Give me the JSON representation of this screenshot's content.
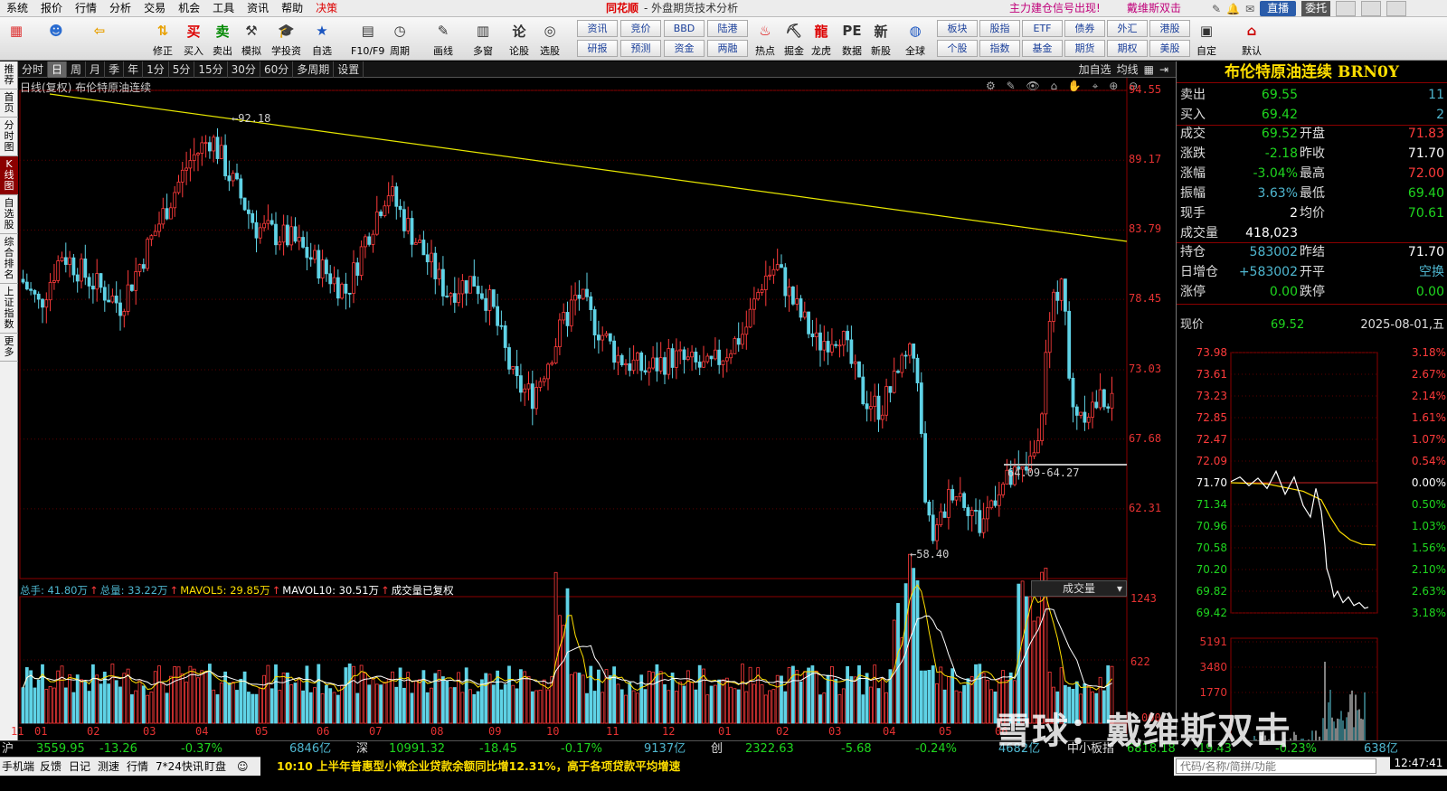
{
  "menu": [
    "系统",
    "报价",
    "行情",
    "分析",
    "交易",
    "机会",
    "工具",
    "资讯",
    "帮助",
    "决策"
  ],
  "app": {
    "logo": "同花顺",
    "title": "外盘期货技术分析",
    "ad1": "主力建仓信号出现!",
    "ad2": "戴维斯双击",
    "live": "直播",
    "login": "委托"
  },
  "toolbar": {
    "icons": [
      {
        "label": "",
        "icon": "grid-icon"
      },
      {
        "label": "",
        "icon": "robot-icon"
      },
      {
        "label": "",
        "icon": "back-arrow-icon"
      },
      {
        "label": "修正",
        "icon": "up-down-icon"
      },
      {
        "label": "买入",
        "icon": "buy-icon"
      },
      {
        "label": "卖出",
        "icon": "sell-icon"
      },
      {
        "label": "模拟",
        "icon": "hammer-icon"
      },
      {
        "label": "学投资",
        "icon": "grad-cap-icon"
      },
      {
        "label": "自选",
        "icon": "star-icon"
      },
      {
        "label": "F10/F9",
        "icon": "f10-icon"
      },
      {
        "label": "周期",
        "icon": "clock-icon"
      },
      {
        "label": "画线",
        "icon": "pen-icon"
      },
      {
        "label": "多窗",
        "icon": "windows-icon"
      },
      {
        "label": "论股",
        "icon": "discuss-icon"
      },
      {
        "label": "选股",
        "icon": "select-icon"
      },
      {
        "label": "热点",
        "icon": "hot-icon"
      },
      {
        "label": "掘金",
        "icon": "gold-icon"
      },
      {
        "label": "龙虎",
        "icon": "dragon-icon"
      },
      {
        "label": "数据",
        "icon": "pe-icon"
      },
      {
        "label": "新股",
        "icon": "ipo-icon"
      },
      {
        "label": "全球",
        "icon": "globe-icon"
      },
      {
        "label": "自定",
        "icon": "custom-icon"
      },
      {
        "label": "默认",
        "icon": "home-icon"
      }
    ],
    "boxes_top": [
      "资讯",
      "竞价",
      "BBD",
      "陆港"
    ],
    "boxes_bottom": [
      "研报",
      "预测",
      "资金",
      "两融"
    ],
    "boxes2_top": [
      "板块",
      "股指",
      "ETF",
      "债券",
      "外汇",
      "港股"
    ],
    "boxes2_bottom": [
      "个股",
      "指数",
      "基金",
      "期货",
      "期权",
      "美股"
    ]
  },
  "leftrail": [
    "推荐",
    "首页",
    "分时图",
    "K线图",
    "自选股",
    "综合排名",
    "上证指数",
    "更多"
  ],
  "periods": [
    "分时",
    "日",
    "周",
    "月",
    "季",
    "年",
    "1分",
    "5分",
    "15分",
    "30分",
    "60分",
    "多周期",
    "设置"
  ],
  "period_right": [
    "加自选",
    "均线"
  ],
  "chart": {
    "title": "日线(复权) 布伦特原油连续",
    "tools": "⚙ ✎ 👁 ⌂ ✋ ⌖ ⊕ ⊖",
    "y_labels": [
      "94.55",
      "89.17",
      "83.79",
      "78.45",
      "73.03",
      "67.68",
      "62.31"
    ],
    "high_mark": "92.18",
    "low_mark": "58.40",
    "range_mark": "64.09-64.27",
    "vol_labels": [
      "1243",
      "622"
    ],
    "months": [
      "11",
      "01",
      "02",
      "03",
      "04",
      "05",
      "06",
      "07",
      "08",
      "09",
      "10",
      "11",
      "12",
      "01",
      "02",
      "03",
      "04",
      "05",
      "06"
    ],
    "vol_legend": [
      {
        "text": "总手: 41.80万",
        "color": "#4fb7d0"
      },
      {
        "text": "总量: 33.22万",
        "color": "#4fb7d0"
      },
      {
        "text": "MAVOL5: 29.85万",
        "color": "#ffdf00"
      },
      {
        "text": "MAVOL10: 30.51万",
        "color": "#ffffff"
      },
      {
        "text": "成交量已复权",
        "color": "#ffffff"
      }
    ],
    "vol_select": "成交量"
  },
  "quote": {
    "title": "布伦特原油连续 BRN0Y",
    "sell": {
      "k": "卖出",
      "v": "69.55",
      "v2": "11"
    },
    "buy": {
      "k": "买入",
      "v": "69.42",
      "v2": "2"
    },
    "rows": [
      {
        "k": "成交",
        "v": "69.52",
        "vc": "#1fd61f",
        "k2": "开盘",
        "v2": "71.83",
        "v2c": "#ff3b3b"
      },
      {
        "k": "涨跌",
        "v": "-2.18",
        "vc": "#1fd61f",
        "k2": "昨收",
        "v2": "71.70",
        "v2c": "#ffffff"
      },
      {
        "k": "涨幅",
        "v": "-3.04%",
        "vc": "#1fd61f",
        "k2": "最高",
        "v2": "72.00",
        "v2c": "#ff3b3b"
      },
      {
        "k": "振幅",
        "v": "3.63%",
        "vc": "#4fb7d0",
        "k2": "最低",
        "v2": "69.40",
        "v2c": "#1fd61f"
      },
      {
        "k": "现手",
        "v": "2",
        "vc": "#ffffff",
        "k2": "均价",
        "v2": "70.61",
        "v2c": "#1fd61f"
      },
      {
        "k": "成交量",
        "v": "418,023",
        "vc": "#ffffff",
        "k2": "",
        "v2": "",
        "v2c": "#ffffff"
      }
    ],
    "rows2": [
      {
        "k": "持仓",
        "v": "583002",
        "vc": "#4fb7d0",
        "k2": "昨结",
        "v2": "71.70",
        "v2c": "#ffffff"
      },
      {
        "k": "日增仓",
        "v": "+583002",
        "vc": "#4fb7d0",
        "k2": "开平",
        "v2": "空换",
        "v2c": "#4fb7d0"
      },
      {
        "k": "涨停",
        "v": "0.00",
        "vc": "#1fd61f",
        "k2": "跌停",
        "v2": "0.00",
        "v2c": "#1fd61f"
      }
    ],
    "now": {
      "k": "现价",
      "v": "69.52",
      "date": "2025-08-01,五"
    },
    "mini_prices": [
      "73.98",
      "73.61",
      "73.23",
      "72.85",
      "72.47",
      "72.09",
      "71.70",
      "71.34",
      "70.96",
      "70.58",
      "70.20",
      "69.82",
      "69.42"
    ],
    "mini_pcts": [
      "3.18%",
      "2.67%",
      "2.14%",
      "1.61%",
      "1.07%",
      "0.54%",
      "0.00%",
      "0.50%",
      "1.03%",
      "1.56%",
      "2.10%",
      "2.63%",
      "3.18%"
    ],
    "mini_vols": [
      "5191",
      "3480",
      "1770"
    ]
  },
  "index_bar": {
    "sh": {
      "k": "沪",
      "v": "3559.95",
      "chg": "-13.26",
      "pct": "-0.37%",
      "amt": "6846亿"
    },
    "sz": {
      "k": "深",
      "v": "10991.32",
      "chg": "-18.45",
      "pct": "-0.17%",
      "amt": "9137亿"
    },
    "cy": {
      "k": "创",
      "v": "2322.63",
      "chg": "-5.68",
      "pct": "-0.24%",
      "amt": "4682亿"
    },
    "zx": {
      "k": "中小板指",
      "v": "6818.18",
      "chg": "-19.43",
      "pct": "-0.23%",
      "amt": "638亿"
    }
  },
  "status": {
    "items": [
      "手机端",
      "反馈",
      "日记",
      "测速",
      "行情",
      "7*24快讯",
      "盯盘"
    ],
    "news": "10:10 上半年普惠型小微企业贷款余额同比增12.31%，高于各项贷款平均增速",
    "search_placeholder": "代码/名称/简拼/功能",
    "clock": "12:47:41"
  },
  "watermark": "雪球：戴维斯双击",
  "colors": {
    "up": "#ff3b3b",
    "down": "#5fd3e6",
    "trend": "#e6e600",
    "ma5": "#ffdf00",
    "ma10": "#ffffff",
    "grid": "#5a0000"
  }
}
